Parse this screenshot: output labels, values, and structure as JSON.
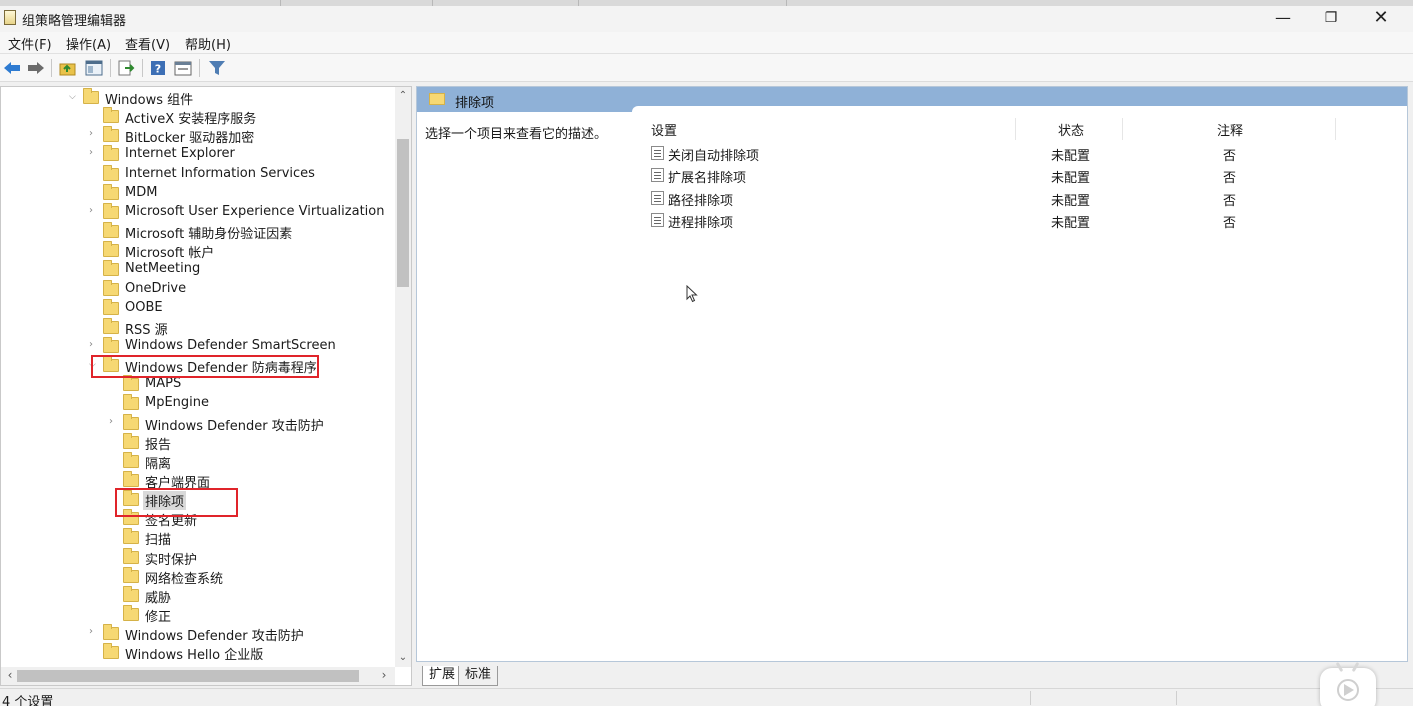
{
  "window": {
    "title": "组策略管理编辑器",
    "minimize_icon": "minimize-icon",
    "restore_icon": "restore-icon",
    "close_icon": "close-icon"
  },
  "menu": [
    "文件(F)",
    "操作(A)",
    "查看(V)",
    "帮助(H)"
  ],
  "toolbar": [
    "back-arrow-icon",
    "forward-arrow-icon",
    "up-folder-icon",
    "show-hide-tree-icon",
    "export-list-icon",
    "help-icon",
    "properties-icon",
    "filter-icon"
  ],
  "tree": {
    "items": [
      {
        "label": "Windows 组件",
        "expanded": true
      },
      {
        "label": "ActiveX 安装程序服务"
      },
      {
        "label": "BitLocker 驱动器加密"
      },
      {
        "label": "Internet Explorer"
      },
      {
        "label": "Internet Information Services"
      },
      {
        "label": "MDM"
      },
      {
        "label": "Microsoft User Experience Virtualization"
      },
      {
        "label": "Microsoft 辅助身份验证因素"
      },
      {
        "label": "Microsoft 帐户"
      },
      {
        "label": "NetMeeting"
      },
      {
        "label": "OneDrive"
      },
      {
        "label": "OOBE"
      },
      {
        "label": "RSS 源"
      },
      {
        "label": "Windows Defender SmartScreen"
      },
      {
        "label": "Windows Defender 防病毒程序",
        "expanded": true,
        "highlighted": true
      },
      {
        "label": "MAPS"
      },
      {
        "label": "MpEngine"
      },
      {
        "label": "Windows Defender 攻击防护"
      },
      {
        "label": "报告"
      },
      {
        "label": "隔离"
      },
      {
        "label": "客户端界面"
      },
      {
        "label": "排除项",
        "selected": true,
        "highlighted": true
      },
      {
        "label": "签名更新"
      },
      {
        "label": "扫描"
      },
      {
        "label": "实时保护"
      },
      {
        "label": "网络检查系统"
      },
      {
        "label": "威胁"
      },
      {
        "label": "修正"
      },
      {
        "label": "Windows Defender 攻击防护"
      },
      {
        "label": "Windows Hello 企业版"
      }
    ]
  },
  "details": {
    "header_title": "排除项",
    "description": "选择一个项目来查看它的描述。",
    "columns": {
      "setting": "设置",
      "state": "状态",
      "comment": "注释"
    },
    "rows": [
      {
        "name": "关闭自动排除项",
        "state": "未配置",
        "comment": "否"
      },
      {
        "name": "扩展名排除项",
        "state": "未配置",
        "comment": "否"
      },
      {
        "name": "路径排除项",
        "state": "未配置",
        "comment": "否"
      },
      {
        "name": "进程排除项",
        "state": "未配置",
        "comment": "否"
      }
    ]
  },
  "tabs": [
    "扩展",
    "标准"
  ],
  "status": {
    "text": "4 个设置"
  },
  "colors": {
    "highlight_box": "#e0242a",
    "header_band": "#8fb1d7",
    "folder": "#f6d873"
  }
}
